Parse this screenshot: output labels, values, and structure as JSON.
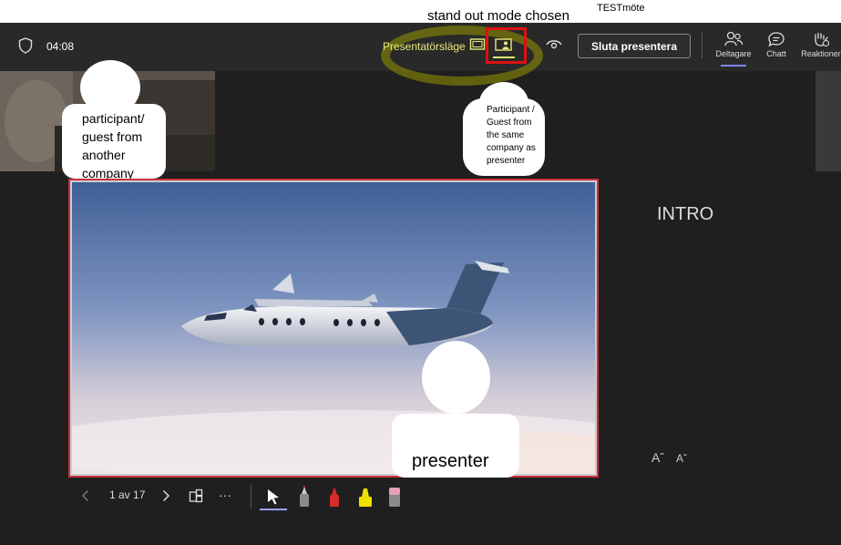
{
  "annotations": {
    "stand_out_note": "stand out mode chosen",
    "guest_other_company": "participant/\nguest from\nanother\ncompany",
    "guest_same_company": "Participant /\nGuest from\nthe same\ncompany as\npresenter",
    "presenter": "presenter"
  },
  "meeting": {
    "title": "TESTmöte",
    "timer": "04:08"
  },
  "presenter_mode": {
    "label": "Presentatörsläge",
    "selected_mode": "stand-out"
  },
  "actions": {
    "stop_presenting": "Sluta presentera",
    "participants": "Deltagare",
    "chat": "Chatt",
    "reactions": "Reaktioner"
  },
  "slide": {
    "notes_heading": "INTRO",
    "counter": "1 av 17"
  },
  "font_controls": {
    "increase": "Aˆ",
    "decrease": "Aˇ"
  },
  "toolbar": {
    "more": "···"
  },
  "colors": {
    "accent": "#7f85f5",
    "mode_yellow": "#e9ea7a",
    "highlight_red": "#dd1111",
    "slide_border": "#c8313d"
  }
}
